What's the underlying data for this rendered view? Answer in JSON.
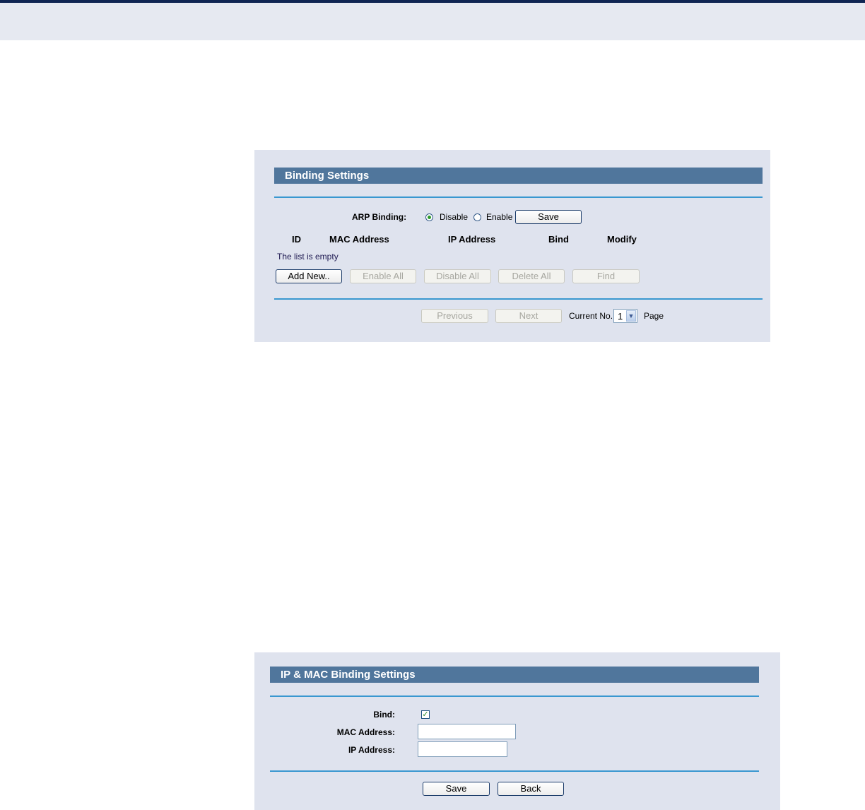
{
  "binding_settings": {
    "title": "Binding Settings",
    "arp_label": "ARP Binding:",
    "disable_label": "Disable",
    "enable_label": "Enable",
    "arp_selected": "Disable",
    "save_label": "Save",
    "columns": [
      "ID",
      "MAC Address",
      "IP Address",
      "Bind",
      "Modify"
    ],
    "empty_text": "The list is empty",
    "actions": {
      "add_new": "Add New..",
      "enable_all": "Enable All",
      "disable_all": "Disable All",
      "delete_all": "Delete All",
      "find": "Find"
    },
    "pager": {
      "previous": "Previous",
      "next": "Next",
      "current_label": "Current No.",
      "current_value": "1",
      "page_label": "Page"
    }
  },
  "ip_mac_binding": {
    "title": "IP & MAC Binding Settings",
    "bind_label": "Bind:",
    "bind_checked": true,
    "mac_label": "MAC Address:",
    "mac_value": "",
    "ip_label": "IP Address:",
    "ip_value": "",
    "save_label": "Save",
    "back_label": "Back"
  },
  "colors": {
    "title_bar": "#50769c",
    "panel_bg": "#dfe3ee",
    "divider": "#3a98d0"
  }
}
